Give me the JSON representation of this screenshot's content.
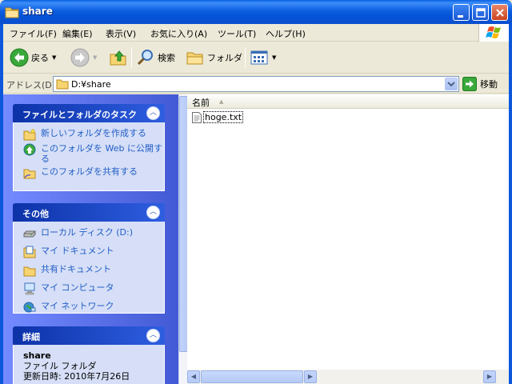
{
  "window": {
    "title": "share"
  },
  "menu": [
    "ファイル(F)",
    "編集(E)",
    "表示(V)",
    "お気に入り(A)",
    "ツール(T)",
    "ヘルプ(H)"
  ],
  "toolbar": {
    "back_label": "戻る",
    "search_label": "検索",
    "folders_label": "フォルダ"
  },
  "address": {
    "label": "アドレス(D)",
    "value": "D:¥share",
    "go_label": "移動"
  },
  "tasks_panel": {
    "title": "ファイルとフォルダのタスク",
    "items": [
      {
        "label": "新しいフォルダを作成する",
        "icon": "new-folder-icon"
      },
      {
        "label": "このフォルダを Web に公開する",
        "icon": "publish-web-icon"
      },
      {
        "label": "このフォルダを共有する",
        "icon": "share-folder-icon"
      }
    ]
  },
  "other_panel": {
    "title": "その他",
    "items": [
      {
        "label": "ローカル ディスク (D:)",
        "icon": "local-disk-icon"
      },
      {
        "label": "マイ ドキュメント",
        "icon": "my-documents-icon"
      },
      {
        "label": "共有ドキュメント",
        "icon": "shared-documents-icon"
      },
      {
        "label": "マイ コンピュータ",
        "icon": "my-computer-icon"
      },
      {
        "label": "マイ ネットワーク",
        "icon": "my-network-icon"
      }
    ]
  },
  "details_panel": {
    "title": "詳細",
    "name": "share",
    "type": "ファイル フォルダ",
    "modified_partial": "更新日時: 2010年7月26日"
  },
  "file_list": {
    "column_header": "名前",
    "files": [
      {
        "name": "hoge.txt",
        "icon": "text-file-icon"
      }
    ]
  },
  "colors": {
    "title_bar": "#0a5fe0",
    "task_link": "#215dc6",
    "pane_background": "#6375d6"
  }
}
